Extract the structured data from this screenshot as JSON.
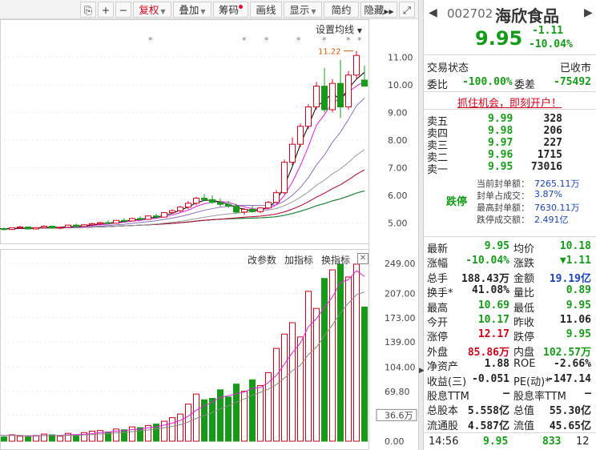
{
  "toolbar": {
    "icons": [
      "restore-icon",
      "zoom-in-icon",
      "zoom-out-icon"
    ],
    "fuquan": "复权",
    "diejia": "叠加",
    "chouma": "筹码",
    "huaxian": "画线",
    "xianshi": "显示",
    "jianyue": "简约",
    "yincang": "隐藏",
    "fullscreen_icon": "expand-icon"
  },
  "chart": {
    "setting_ma": "设置均线",
    "high_label": "11.22",
    "price_axis": [
      "11.00",
      "10.00",
      "9.00",
      "8.00",
      "7.00",
      "6.00",
      "5.00"
    ],
    "volume_axis": [
      "249.00",
      "207.00",
      "173.00",
      "139.00",
      "104.00",
      "69.80",
      "36.6万",
      "0.00"
    ],
    "indicator": {
      "params": "改参数",
      "add": "加指标",
      "swap": "换指标"
    }
  },
  "chart_data": {
    "type": "bar",
    "title": "",
    "price_ylim": [
      4.5,
      11.5
    ],
    "volume_ylim": [
      0,
      249
    ],
    "candles": [
      [
        4.8,
        4.86,
        4.76,
        4.82
      ],
      [
        4.82,
        4.88,
        4.78,
        4.8
      ],
      [
        4.8,
        4.84,
        4.74,
        4.77
      ],
      [
        4.77,
        4.85,
        4.75,
        4.83
      ],
      [
        4.83,
        4.9,
        4.8,
        4.86
      ],
      [
        4.86,
        4.88,
        4.78,
        4.79
      ],
      [
        4.79,
        4.86,
        4.77,
        4.84
      ],
      [
        4.84,
        4.92,
        4.82,
        4.89
      ],
      [
        4.89,
        4.92,
        4.8,
        4.82
      ],
      [
        4.82,
        4.88,
        4.78,
        4.85
      ],
      [
        4.85,
        4.95,
        4.83,
        4.93
      ],
      [
        4.93,
        4.98,
        4.86,
        4.88
      ],
      [
        4.88,
        4.96,
        4.85,
        4.94
      ],
      [
        4.94,
        5.02,
        4.9,
        4.98
      ],
      [
        4.98,
        5.05,
        4.92,
        5.02
      ],
      [
        5.02,
        5.1,
        4.96,
        5.0
      ],
      [
        5.0,
        5.12,
        4.98,
        5.1
      ],
      [
        5.1,
        5.18,
        5.04,
        5.08
      ],
      [
        5.08,
        5.2,
        5.06,
        5.17
      ],
      [
        5.17,
        5.25,
        5.1,
        5.14
      ],
      [
        5.14,
        5.28,
        5.12,
        5.26
      ],
      [
        5.26,
        5.34,
        5.18,
        5.22
      ],
      [
        5.22,
        5.4,
        5.2,
        5.38
      ],
      [
        5.38,
        5.5,
        5.34,
        5.45
      ],
      [
        5.45,
        5.62,
        5.4,
        5.58
      ],
      [
        5.58,
        5.8,
        5.5,
        5.72
      ],
      [
        5.72,
        5.95,
        5.65,
        5.9
      ],
      [
        5.9,
        6.05,
        5.8,
        5.85
      ],
      [
        5.85,
        6.0,
        5.7,
        5.75
      ],
      [
        5.75,
        5.9,
        5.6,
        5.68
      ],
      [
        5.68,
        5.8,
        5.55,
        5.62
      ],
      [
        5.62,
        5.7,
        5.35,
        5.4
      ],
      [
        5.4,
        5.55,
        5.3,
        5.5
      ],
      [
        5.5,
        5.62,
        5.38,
        5.42
      ],
      [
        5.42,
        5.58,
        5.36,
        5.55
      ],
      [
        5.55,
        5.8,
        5.5,
        5.75
      ],
      [
        5.75,
        6.2,
        5.7,
        6.1
      ],
      [
        6.1,
        7.3,
        6.05,
        7.2
      ],
      [
        7.2,
        8.1,
        7.1,
        7.85
      ],
      [
        7.85,
        8.6,
        7.75,
        8.5
      ],
      [
        8.5,
        9.3,
        8.4,
        9.2
      ],
      [
        9.2,
        10.1,
        9.1,
        9.95
      ],
      [
        9.95,
        10.6,
        9.0,
        9.1
      ],
      [
        9.1,
        10.2,
        9.0,
        10.05
      ],
      [
        10.05,
        10.9,
        8.8,
        9.2
      ],
      [
        9.2,
        10.5,
        9.1,
        10.35
      ],
      [
        10.35,
        11.22,
        10.2,
        11.06
      ],
      [
        10.17,
        10.69,
        9.95,
        9.95
      ]
    ],
    "volumes": [
      10,
      8,
      6,
      9,
      7,
      6,
      8,
      10,
      9,
      7,
      11,
      9,
      12,
      14,
      15,
      13,
      17,
      16,
      20,
      19,
      22,
      24,
      28,
      33,
      38,
      52,
      66,
      58,
      60,
      72,
      62,
      80,
      70,
      86,
      78,
      96,
      130,
      150,
      166,
      146,
      210,
      186,
      228,
      240,
      248,
      230,
      248,
      188
    ]
  },
  "panel": {
    "code": "002702",
    "name": "海欣食品",
    "price": "9.95",
    "change": "-1.11",
    "change_pct": "-10.04%",
    "trade_status_label": "交易状态",
    "trade_status": "已收市",
    "weibi_label": "委比",
    "weibi": "-100.00%",
    "weicha_label": "委差",
    "weicha": "-75492",
    "promo": "抓住机会，即刻开户！",
    "sells": [
      {
        "label": "卖五",
        "price": "9.99",
        "vol": "328"
      },
      {
        "label": "卖四",
        "price": "9.98",
        "vol": "206"
      },
      {
        "label": "卖三",
        "price": "9.97",
        "vol": "227"
      },
      {
        "label": "卖二",
        "price": "9.96",
        "vol": "1715"
      },
      {
        "label": "卖一",
        "price": "9.95",
        "vol": "73016"
      }
    ],
    "limit_down_label": "跌停",
    "seal": [
      {
        "label": "当前封单额：",
        "value": "7265.11万"
      },
      {
        "label": "封单占成交：",
        "value": "3.87%"
      },
      {
        "label": "最高封单额：",
        "value": "7630.11万"
      },
      {
        "label": "跌停成交额：",
        "value": "2.491亿"
      }
    ],
    "stats": [
      {
        "l1": "最新",
        "v1": "9.95",
        "c1": "green",
        "l2": "均价",
        "v2": "10.18",
        "c2": "green"
      },
      {
        "l1": "涨幅",
        "v1": "-10.04%",
        "c1": "green",
        "l2": "涨跌",
        "v2": "▼1.11",
        "c2": "green"
      },
      {
        "l1": "总手",
        "v1": "188.43万",
        "c1": "",
        "l2": "金额",
        "v2": "19.19亿",
        "c2": "blue"
      },
      {
        "l1": "换手*",
        "v1": "41.08%",
        "c1": "",
        "l2": "量比",
        "v2": "0.89",
        "c2": "green"
      },
      {
        "l1": "最高",
        "v1": "10.69",
        "c1": "green",
        "l2": "最低",
        "v2": "9.95",
        "c2": "green"
      },
      {
        "l1": "今开",
        "v1": "10.17",
        "c1": "green",
        "l2": "昨收",
        "v2": "11.06",
        "c2": ""
      },
      {
        "l1": "涨停",
        "v1": "12.17",
        "c1": "red",
        "l2": "跌停",
        "v2": "9.95",
        "c2": "green"
      },
      {
        "l1": "外盘",
        "v1": "85.86万",
        "c1": "red",
        "l2": "内盘",
        "v2": "102.57万",
        "c2": "green"
      },
      {
        "l1": "净资产",
        "v1": "1.88",
        "c1": "",
        "l2": "ROE",
        "v2": "-2.66%",
        "c2": ""
      },
      {
        "l1": "收益(三)",
        "v1": "-0.051",
        "c1": "",
        "l2": "PE(动)*",
        "v2": "-147.14",
        "c2": ""
      },
      {
        "l1": "股息TTM",
        "v1": "—",
        "c1": "",
        "l2": "股息率TTM",
        "v2": "—",
        "c2": ""
      },
      {
        "l1": "总股本",
        "v1": "5.558亿",
        "c1": "",
        "l2": "总值",
        "v2": "55.30亿",
        "c2": ""
      },
      {
        "l1": "流通股",
        "v1": "4.587亿",
        "c1": "",
        "l2": "流值",
        "v2": "45.65亿",
        "c2": ""
      }
    ],
    "tick": {
      "time": "14:56",
      "price": "9.95",
      "vol": "833",
      "count": "12"
    }
  },
  "colors": {
    "up": "#d0021b",
    "down": "#169b18",
    "ma5": "#000000",
    "ma10": "#e01ee0",
    "ma20": "#8a6fc0",
    "ma30": "#999999",
    "ma60": "#b0002a",
    "ma120": "#1f8a1f",
    "ma250": "#1a44b8"
  }
}
